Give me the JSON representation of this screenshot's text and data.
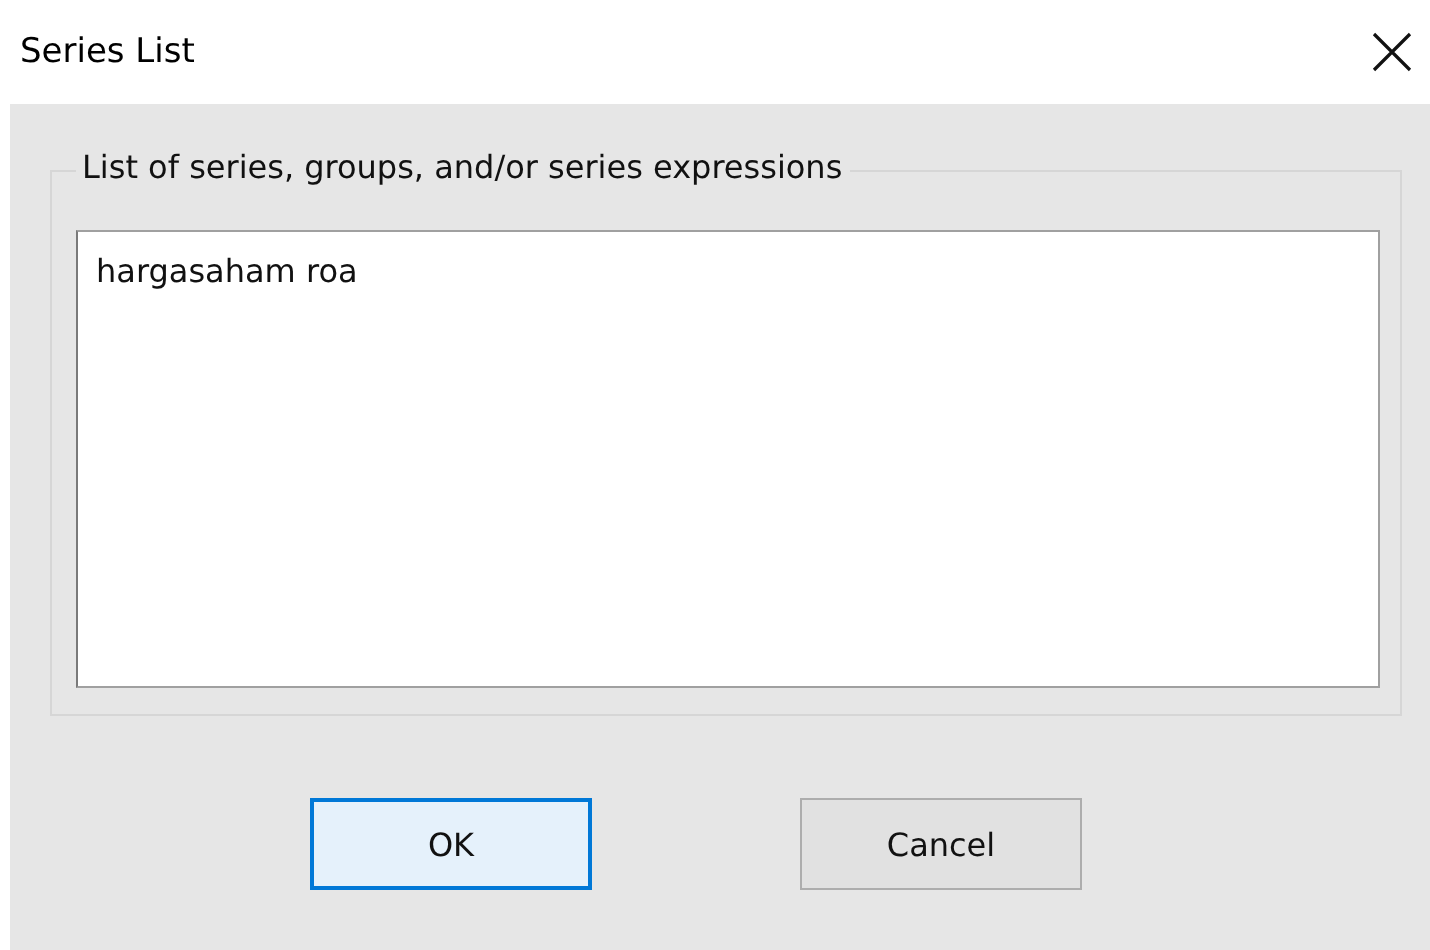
{
  "window": {
    "title": "Series List"
  },
  "group": {
    "label": "List of series, groups, and/or series expressions",
    "value": "hargasaham roa"
  },
  "buttons": [
    {
      "label": "OK",
      "default": true
    },
    {
      "label": "Cancel",
      "default": false
    }
  ]
}
